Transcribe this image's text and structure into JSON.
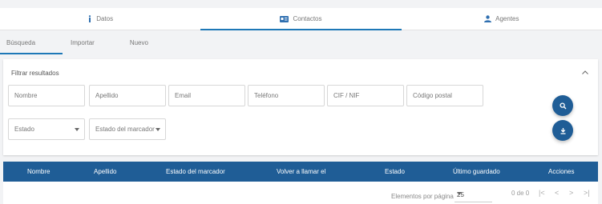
{
  "top_tabs": [
    {
      "label": "Datos",
      "icon": "info-icon"
    },
    {
      "label": "Contactos",
      "icon": "contact-card-icon"
    },
    {
      "label": "Agentes",
      "icon": "person-icon"
    }
  ],
  "sub_tabs": [
    "Búsqueda",
    "Importar",
    "Nuevo"
  ],
  "filter": {
    "title": "Filtrar resultados",
    "fields": {
      "nombre": "Nombre",
      "apellido": "Apellido",
      "email": "Email",
      "telefono": "Teléfono",
      "cif": "CIF / NIF",
      "postal": "Código postal"
    },
    "selects": {
      "estado": "Estado",
      "estado_marcador": "Estado del marcador"
    }
  },
  "table": {
    "columns": [
      "Nombre",
      "Apellido",
      "Estado del marcador",
      "Volver a llamar el",
      "Estado",
      "Último guardado",
      "Acciones"
    ]
  },
  "pagination": {
    "items_label": "Elementos por página",
    "page_size": "25",
    "count": "0 de 0"
  },
  "colors": {
    "accent": "#1f5d96",
    "tab_underline": "#1e78b7"
  }
}
